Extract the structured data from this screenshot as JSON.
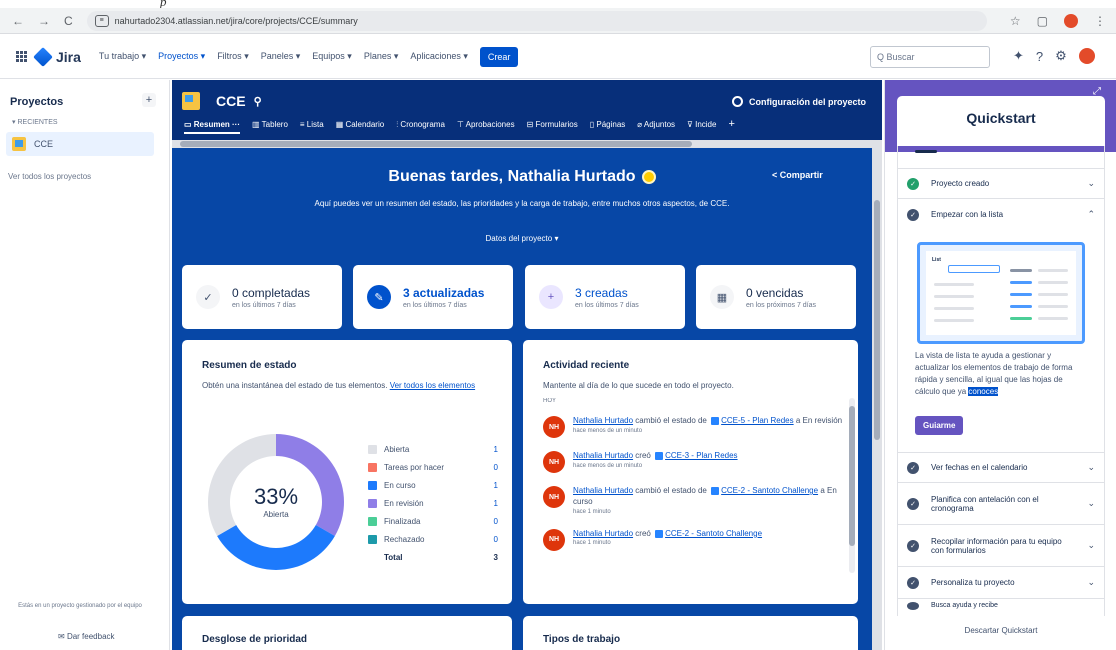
{
  "browser": {
    "url": "nahurtado2304.atlassian.net/jira/core/projects/CCE/summary",
    "nav_back": "←",
    "nav_forward": "→",
    "nav_reload": "C"
  },
  "topnav": {
    "logo": "Jira",
    "menu": [
      "Tu trabajo ▾",
      "Proyectos ▾",
      "Filtros ▾",
      "Paneles ▾",
      "Equipos ▾",
      "Planes ▾",
      "Aplicaciones ▾"
    ],
    "create": "Crear",
    "search_placeholder": "Q  Buscar"
  },
  "sidebar": {
    "heading": "Proyectos",
    "recent_label": "RECIENTES",
    "project": "CCE",
    "all_projects": "Ver todos los proyectos",
    "footer_note": "Estás en un proyecto gestionado por el equipo",
    "feedback": "Dar feedback"
  },
  "project": {
    "name": "CCE",
    "config": "Configuración del proyecto",
    "tabs": [
      "Resumen",
      "Tablero",
      "Lista",
      "Calendario",
      "Cronograma",
      "Aprobaciones",
      "Formularios",
      "Páginas",
      "Adjuntos",
      "Incide"
    ]
  },
  "summary": {
    "greeting": "Buenas tardes, Nathalia Hurtado",
    "share": "Compartir",
    "subtitle": "Aquí puedes ver un resumen del estado, las prioridades y la carga de trabajo, entre muchos otros aspectos, de CCE.",
    "project_data": "Datos del proyecto  ▾"
  },
  "stats": [
    {
      "count": "0 completadas",
      "label": "en los últimos 7 días",
      "icon": "✓"
    },
    {
      "count": "3 actualizadas",
      "label": "en los últimos 7 días",
      "icon": "✎"
    },
    {
      "count": "3 creadas",
      "label": "en los últimos 7 días",
      "icon": "+"
    },
    {
      "count": "0 vencidas",
      "label": "en los próximos 7 días",
      "icon": "▦"
    }
  ],
  "status_card": {
    "title": "Resumen de estado",
    "desc": "Obtén una instantánea del estado de tus elementos.",
    "link": "Ver todos los elementos",
    "center_pct": "33%",
    "center_label": "Abierta",
    "legend": [
      {
        "name": "Abierta",
        "count": "1",
        "color": "#dfe1e6"
      },
      {
        "name": "Tareas por hacer",
        "count": "0",
        "color": "#f87462"
      },
      {
        "name": "En curso",
        "count": "1",
        "color": "#1d7afc"
      },
      {
        "name": "En revisión",
        "count": "1",
        "color": "#8f7ee7"
      },
      {
        "name": "Finalizada",
        "count": "0",
        "color": "#4bce97"
      },
      {
        "name": "Rechazado",
        "count": "0",
        "color": "#1d9aaa"
      }
    ],
    "total_label": "Total",
    "total_count": "3"
  },
  "chart_data": {
    "type": "pie",
    "categories": [
      "Abierta",
      "Tareas por hacer",
      "En curso",
      "En revisión",
      "Finalizada",
      "Rechazado"
    ],
    "values": [
      1,
      0,
      1,
      1,
      0,
      0
    ],
    "colors": [
      "#dfe1e6",
      "#f87462",
      "#1d7afc",
      "#8f7ee7",
      "#4bce97",
      "#1d9aaa"
    ]
  },
  "activity_card": {
    "title": "Actividad reciente",
    "desc": "Mantente al día de lo que sucede en todo el proyecto.",
    "group": "HOY",
    "items": [
      {
        "user": "Nathalia Hurtado",
        "pre": "cambió el estado de",
        "item": "CCE-5 - Plan Redes",
        "post": "a En revisión",
        "time": "hace menos de un minuto"
      },
      {
        "user": "Nathalia Hurtado",
        "pre": "creó",
        "item": "CCE-3 - Plan Redes",
        "post": "",
        "time": "hace menos de un minuto"
      },
      {
        "user": "Nathalia Hurtado",
        "pre": "cambió el estado de",
        "item": "CCE-2 - Santoto Challenge",
        "post": "a En curso",
        "time": "hace 1 minuto"
      },
      {
        "user": "Nathalia Hurtado",
        "pre": "creó",
        "item": "CCE-2 - Santoto Challenge",
        "post": "",
        "time": "hace 1 minuto"
      }
    ],
    "avatar": "NH"
  },
  "bottom_cards": {
    "priority": "Desglose de prioridad",
    "types": "Tipos de trabajo"
  },
  "quickstart": {
    "title": "Quickstart",
    "items": [
      {
        "label": "Proyecto creado",
        "state": "done"
      },
      {
        "label": "Empezar con la lista",
        "state": "done"
      },
      {
        "label": "Ver fechas en el calendario",
        "state": "todo"
      },
      {
        "label": "Planifica con antelación con el cronograma",
        "state": "todo"
      },
      {
        "label": "Recopilar información para tu equipo con formularios",
        "state": "todo"
      },
      {
        "label": "Personaliza tu proyecto",
        "state": "todo"
      },
      {
        "label": "Busca ayuda y recibe",
        "state": "todo"
      }
    ],
    "illus_label": "List",
    "para_before": "La vista de lista te ayuda a gestionar y actualizar los elementos de trabajo de forma rápida y sencilla, al igual que las hojas de cálculo que ya",
    "para_hl": "conoces",
    "guide": "Guiarme",
    "dismiss": "Descartar Quickstart"
  }
}
